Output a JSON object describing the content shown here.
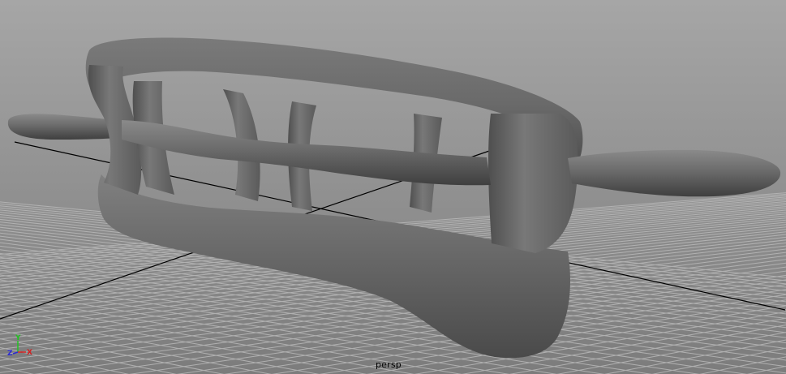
{
  "viewport": {
    "camera_label": "persp",
    "background_top": "#a9a9a9",
    "background_bottom": "#7b7b7b",
    "grid_color": "#b8b8b8",
    "axis_line_color": "#000000",
    "mesh_color": "#6e6e6e"
  },
  "axis_gizmo": {
    "x_label": "X",
    "y_label": "Y",
    "z_label": "Z",
    "x_color": "#d21e1e",
    "y_color": "#22c222",
    "z_color": "#2a2ad4"
  }
}
